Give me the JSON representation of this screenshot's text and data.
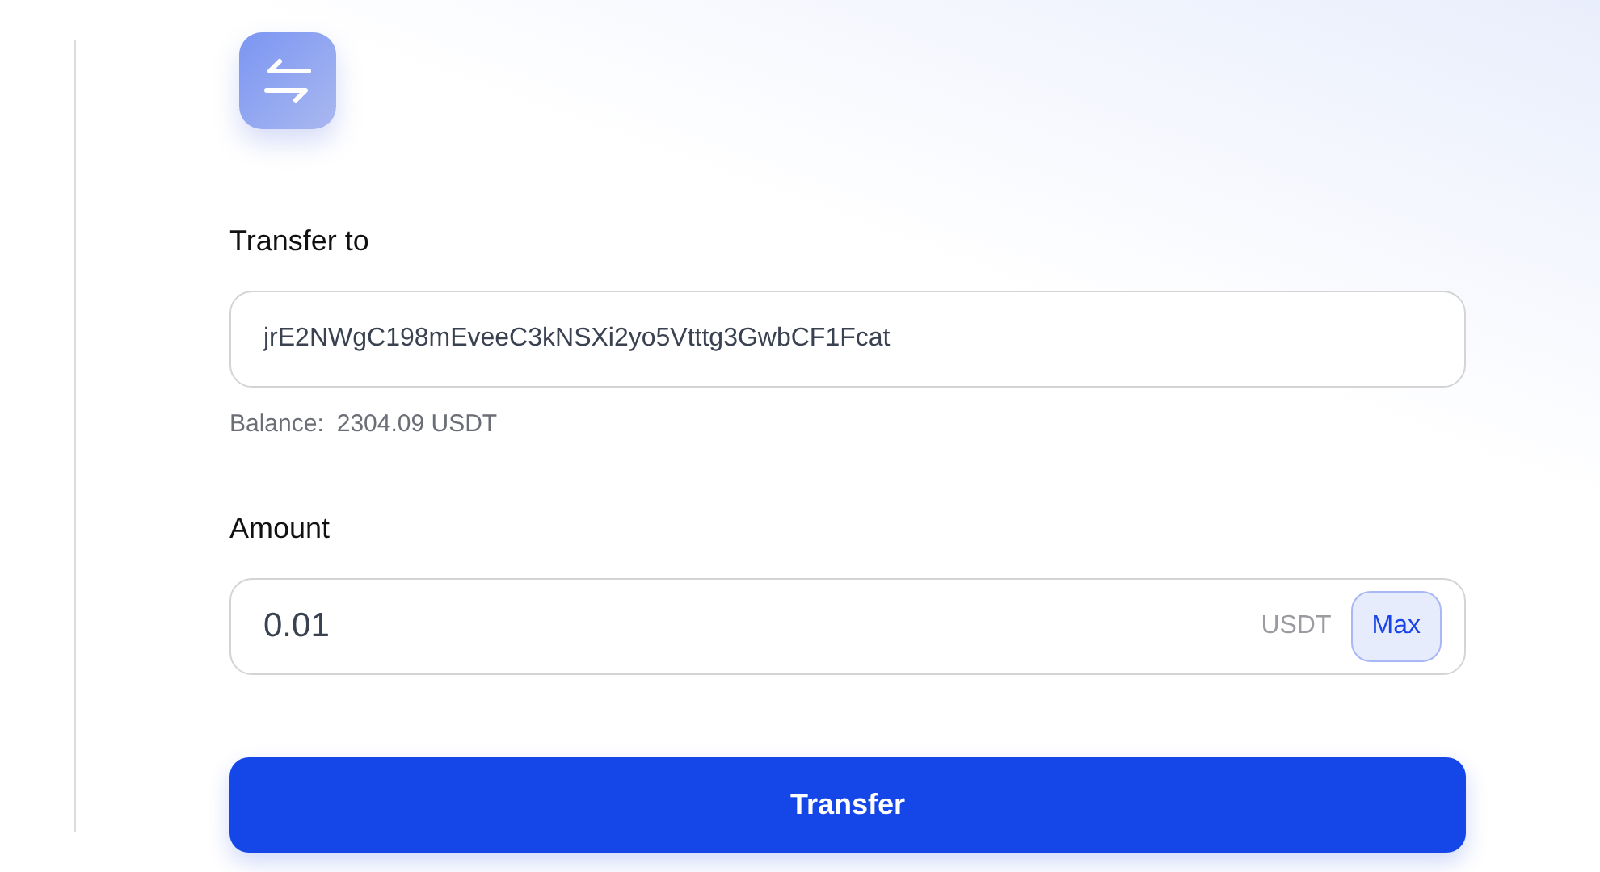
{
  "recipient": {
    "label": "Transfer to",
    "value": "jrE2NWgC198mEveeC3kNSXi2yo5Vtttg3GwbCF1Fcat"
  },
  "balance": {
    "label": "Balance:",
    "value": "2304.09 USDT"
  },
  "amount": {
    "label": "Amount",
    "value": "0.01",
    "unit": "USDT",
    "max_button": "Max"
  },
  "submit_button": "Transfer"
}
